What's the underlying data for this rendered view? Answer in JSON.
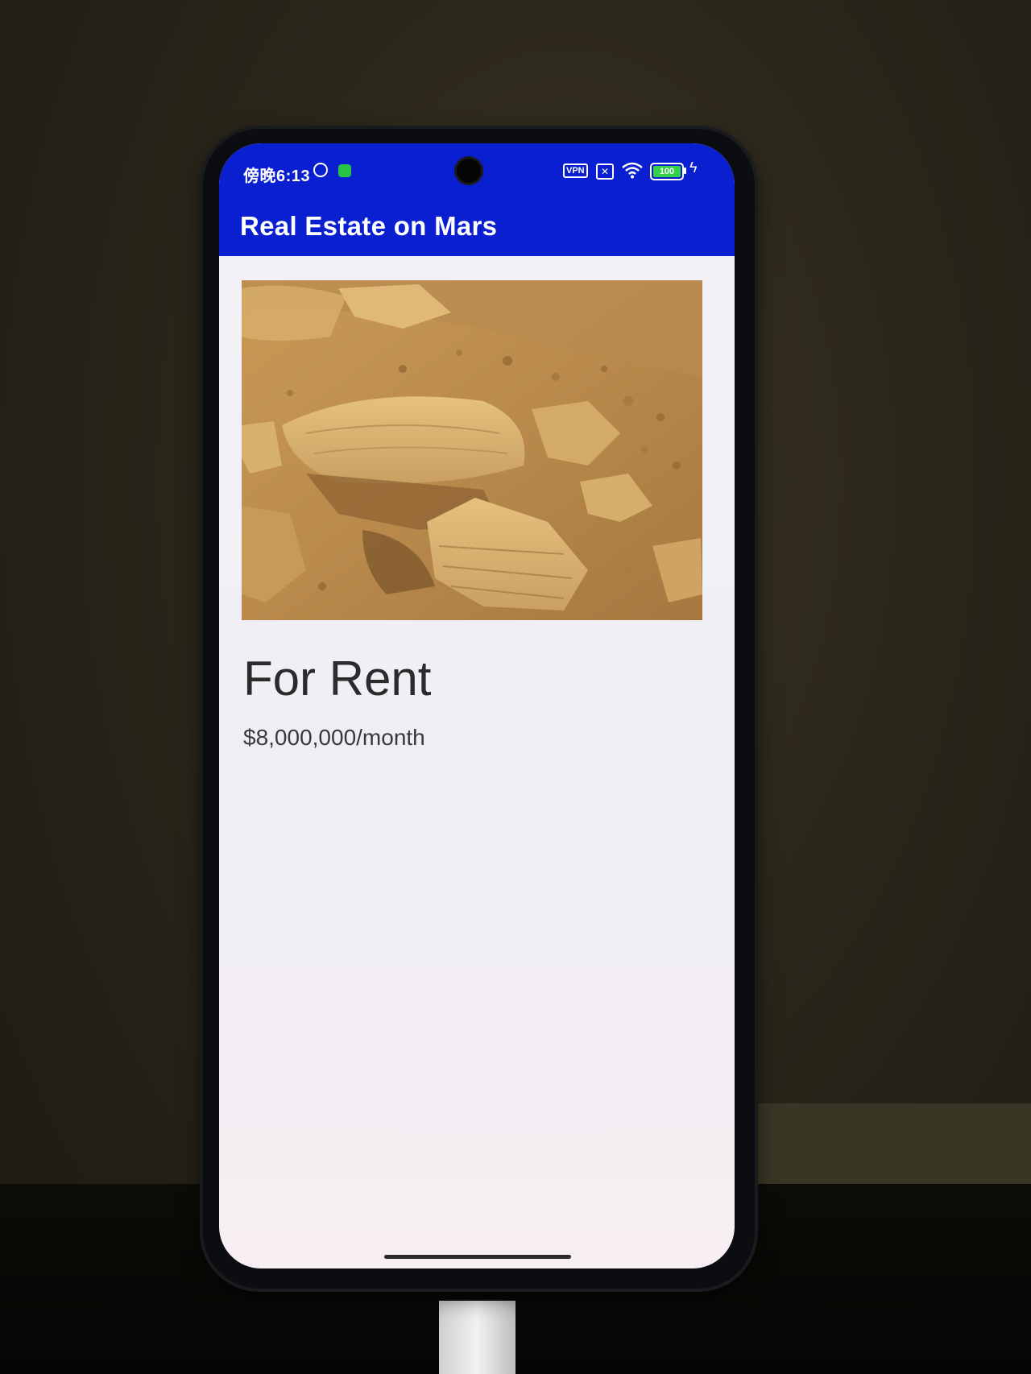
{
  "status_bar": {
    "time": "傍晚6:13",
    "vpn_label": "VPN",
    "sim_label": "✕",
    "battery_level": "100",
    "icons": [
      "alarm-icon",
      "app-notification-icon",
      "vpn-icon",
      "sim-icon",
      "wifi-icon",
      "battery-icon",
      "charging-icon"
    ],
    "bar_color": "#0a1fd0"
  },
  "app_bar": {
    "title": "Real Estate on Mars",
    "color": "#0a1fd0"
  },
  "listing": {
    "photo_icon": "mars-surface-photo",
    "type": "For Rent",
    "price": "$8,000,000/month"
  }
}
